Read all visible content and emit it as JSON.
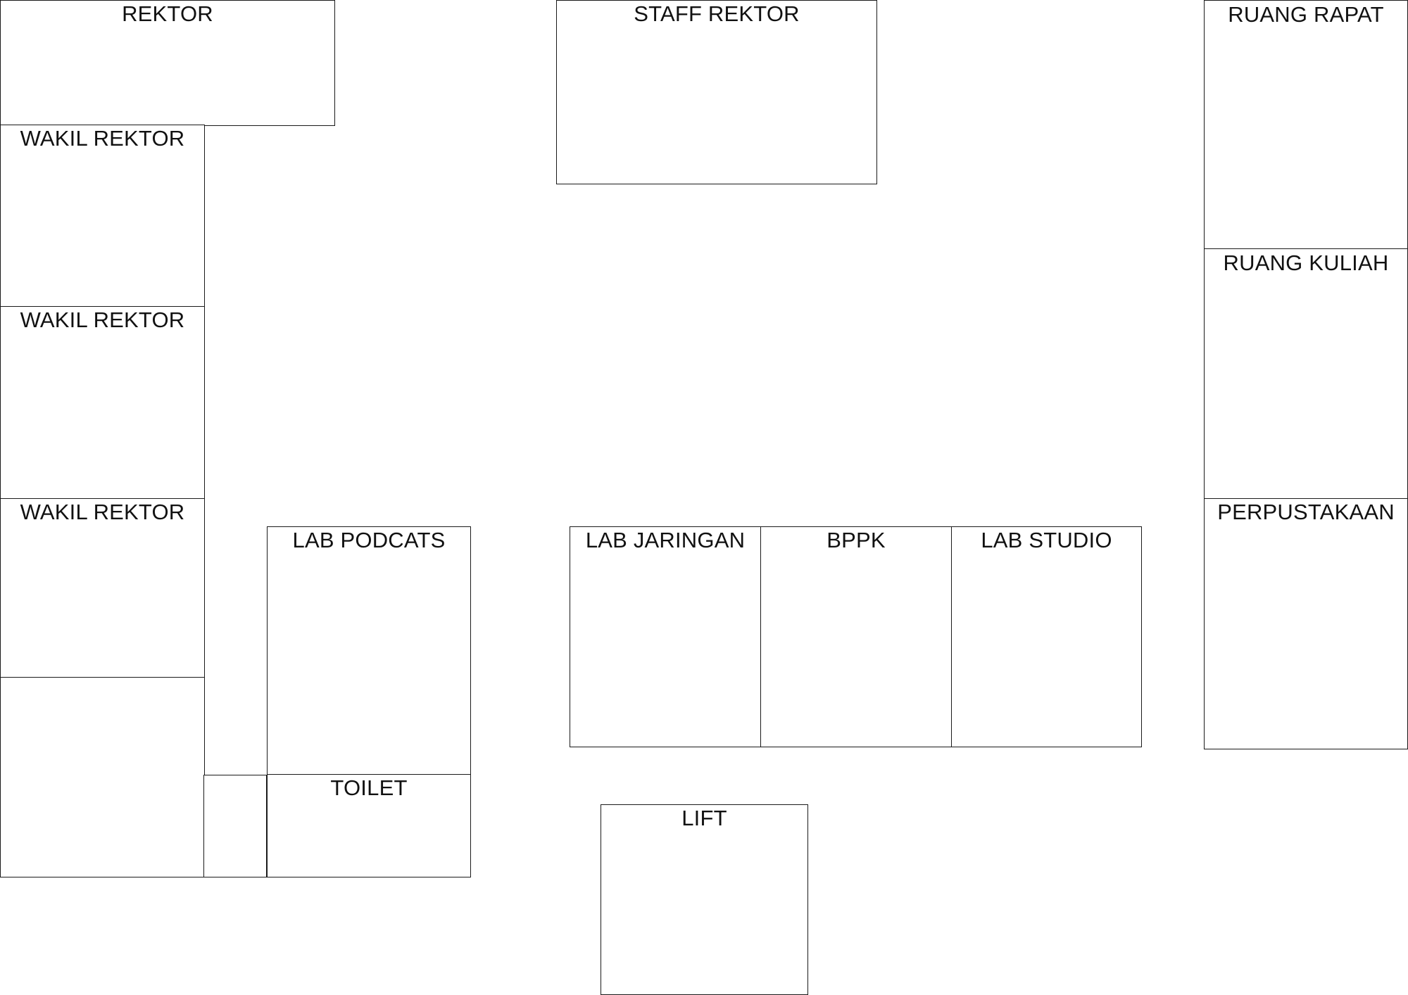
{
  "floor_plan": {
    "rooms": {
      "rektor": "REKTOR",
      "staff_rektor": "STAFF REKTOR",
      "ruang_rapat": "RUANG RAPAT",
      "ruang_kuliah": "RUANG KULIAH",
      "perpustakaan": "PERPUSTAKAAN",
      "wakil_rektor_1": "WAKIL REKTOR",
      "wakil_rektor_2": "WAKIL REKTOR",
      "wakil_rektor_3": "WAKIL REKTOR",
      "lab_podcats": "LAB PODCATS",
      "toilet": "TOILET",
      "lab_jaringan": "LAB JARINGAN",
      "bppk": "BPPK",
      "lab_studio": "LAB STUDIO",
      "lift": "LIFT"
    }
  }
}
